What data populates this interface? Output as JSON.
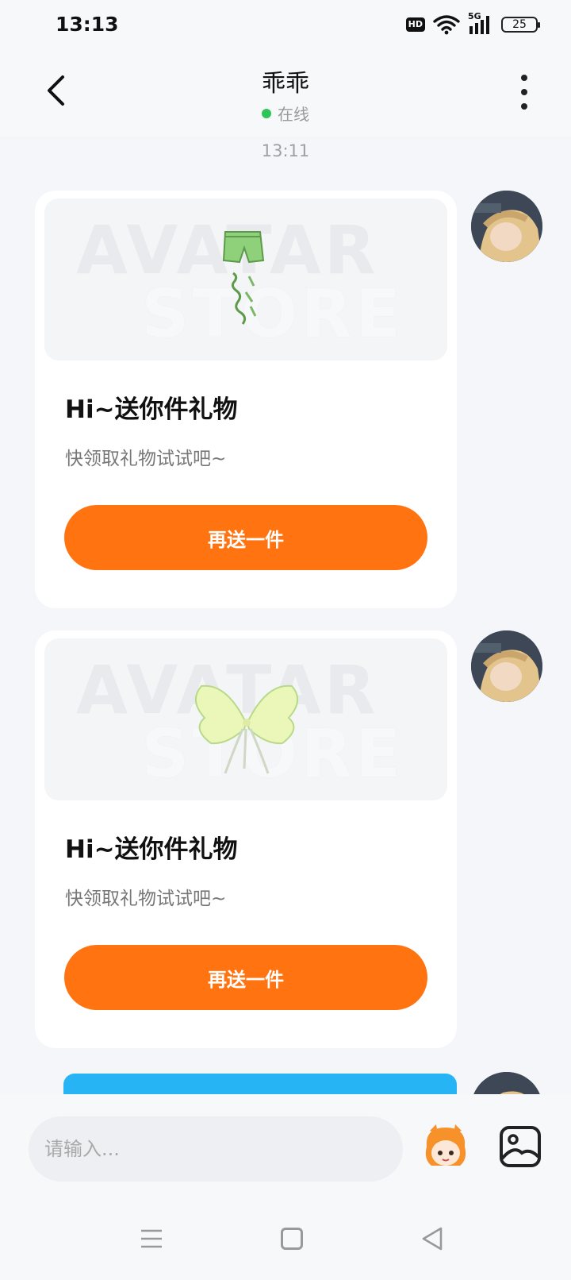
{
  "status_bar": {
    "time": "13:13",
    "hd_badge": "HD",
    "network": "5G",
    "battery": "25"
  },
  "header": {
    "title": "乖乖",
    "status": "在线"
  },
  "chat": {
    "timestamp": "13:11",
    "cards": [
      {
        "watermark_top": "AVATAR",
        "watermark_bottom": "STORE",
        "title": "Hi~送你件礼物",
        "subtitle": "快领取礼物试试吧~",
        "button": "再送一件",
        "gift_icon": "green-shorts-icon"
      },
      {
        "watermark_top": "AVATAR",
        "watermark_bottom": "STORE",
        "title": "Hi~送你件礼物",
        "subtitle": "快领取礼物试试吧~",
        "button": "再送一件",
        "gift_icon": "butterfly-wings-icon"
      }
    ]
  },
  "input_bar": {
    "placeholder": "请输入..."
  },
  "colors": {
    "accent": "#ff7410",
    "online": "#2fc45a",
    "blue_card": "#27b4f5",
    "background": "#f4f6f9"
  }
}
